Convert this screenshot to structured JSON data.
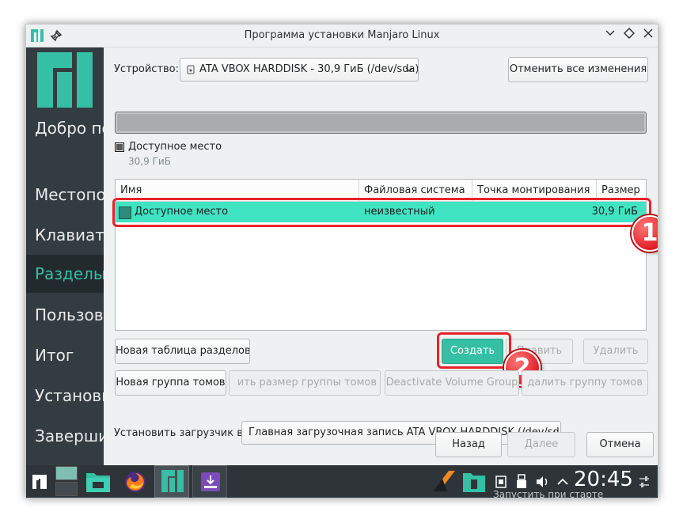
{
  "window": {
    "title": "Программа установки Manjaro Linux",
    "buttons": [
      "minimize",
      "maximize",
      "close"
    ]
  },
  "sidebar": {
    "items": [
      {
        "label": "Добро пожаловать",
        "active": false
      },
      {
        "label": "Местоположение",
        "active": false
      },
      {
        "label": "Клавиатура",
        "active": false
      },
      {
        "label": "Разделы",
        "active": true
      },
      {
        "label": "Пользователи",
        "active": false
      },
      {
        "label": "Итог",
        "active": false
      },
      {
        "label": "Установить",
        "active": false
      },
      {
        "label": "Завершить",
        "active": false
      }
    ]
  },
  "device": {
    "label": "Устройство:",
    "selected": "ATA VBOX HARDDISK - 30,9 ГиБ (/dev/sda)",
    "revert_button": "Отменить все изменения"
  },
  "legend": {
    "label": "Доступное место",
    "size": "30,9 ГиБ"
  },
  "table": {
    "columns": [
      "Имя",
      "Файловая система",
      "Точка монтирования",
      "Размер"
    ],
    "rows": [
      {
        "name": "Доступное место",
        "fs": "неизвестный",
        "mount": "",
        "size": "30,9 ГиБ",
        "selected": true
      }
    ]
  },
  "actions": {
    "new_table": "Новая таблица разделов",
    "create": "Создать",
    "edit": "Править",
    "delete": "Удалить",
    "new_vg": "Новая группа томов",
    "resize_vg": "Изменить размер группы томов",
    "deactivate_vg": "Deactivate Volume Group",
    "remove_vg": "Удалить группу томов"
  },
  "bootloader": {
    "label": "Установить загрузчик в:",
    "selected": "Главная загрузочная запись ATA VBOX HARDDISK (/dev/sda)"
  },
  "nav": {
    "back": "Назад",
    "next": "Далее",
    "cancel": "Отмена"
  },
  "annotations": [
    "1",
    "2"
  ],
  "taskbar": {
    "clock": "20:45",
    "status_text": "Запустить при старте",
    "colors": {
      "accent": "#35bfa4",
      "selection": "#40e3c2",
      "highlight": "#e8232a"
    }
  }
}
